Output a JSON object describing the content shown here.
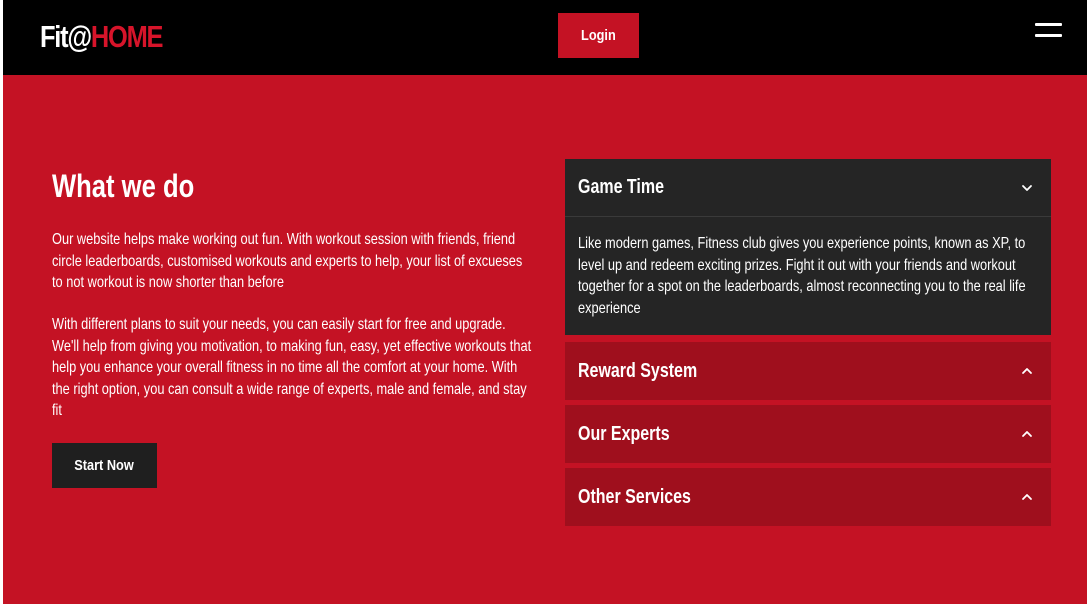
{
  "navbar": {
    "brand_part1": "Fit@",
    "brand_part2": "HOME",
    "login_label": "Login",
    "menu_icon": "hamburger-menu-icon"
  },
  "main": {
    "heading": "What we do",
    "paragraph1": "Our website helps make working out fun. With workout session with friends, friend circle leaderboards, customised workouts and experts to help, your list of excueses to not workout is now shorter than before",
    "paragraph2": "With different plans to suit your needs, you can easily start for free and upgrade. We'll help from giving you motivation, to making fun, easy, yet effective workouts that help you enhance your overall fitness in no time all the comfort at your home. With the right option, you can consult a wide range of experts, male and female, and stay fit",
    "start_label": "Start Now"
  },
  "accordion": {
    "items": [
      {
        "title": "Game Time",
        "expanded": true,
        "icon": "chevron-down-icon",
        "body": "Like modern games, Fitness club gives you experience points, known as XP, to level up and redeem exciting prizes. Fight it out with your friends and workout together for a spot on the leaderboards, almost reconnecting you to the real life experience"
      },
      {
        "title": "Reward System",
        "expanded": false,
        "icon": "chevron-up-icon"
      },
      {
        "title": "Our Experts",
        "expanded": false,
        "icon": "chevron-up-icon"
      },
      {
        "title": "Other Services",
        "expanded": false,
        "icon": "chevron-up-icon"
      }
    ]
  },
  "colors": {
    "primary_red": "#c41224",
    "dark_red": "#9f0f1d",
    "navbar_black": "#000000",
    "panel_dark": "#252525",
    "button_dark": "#1f1f1f"
  }
}
